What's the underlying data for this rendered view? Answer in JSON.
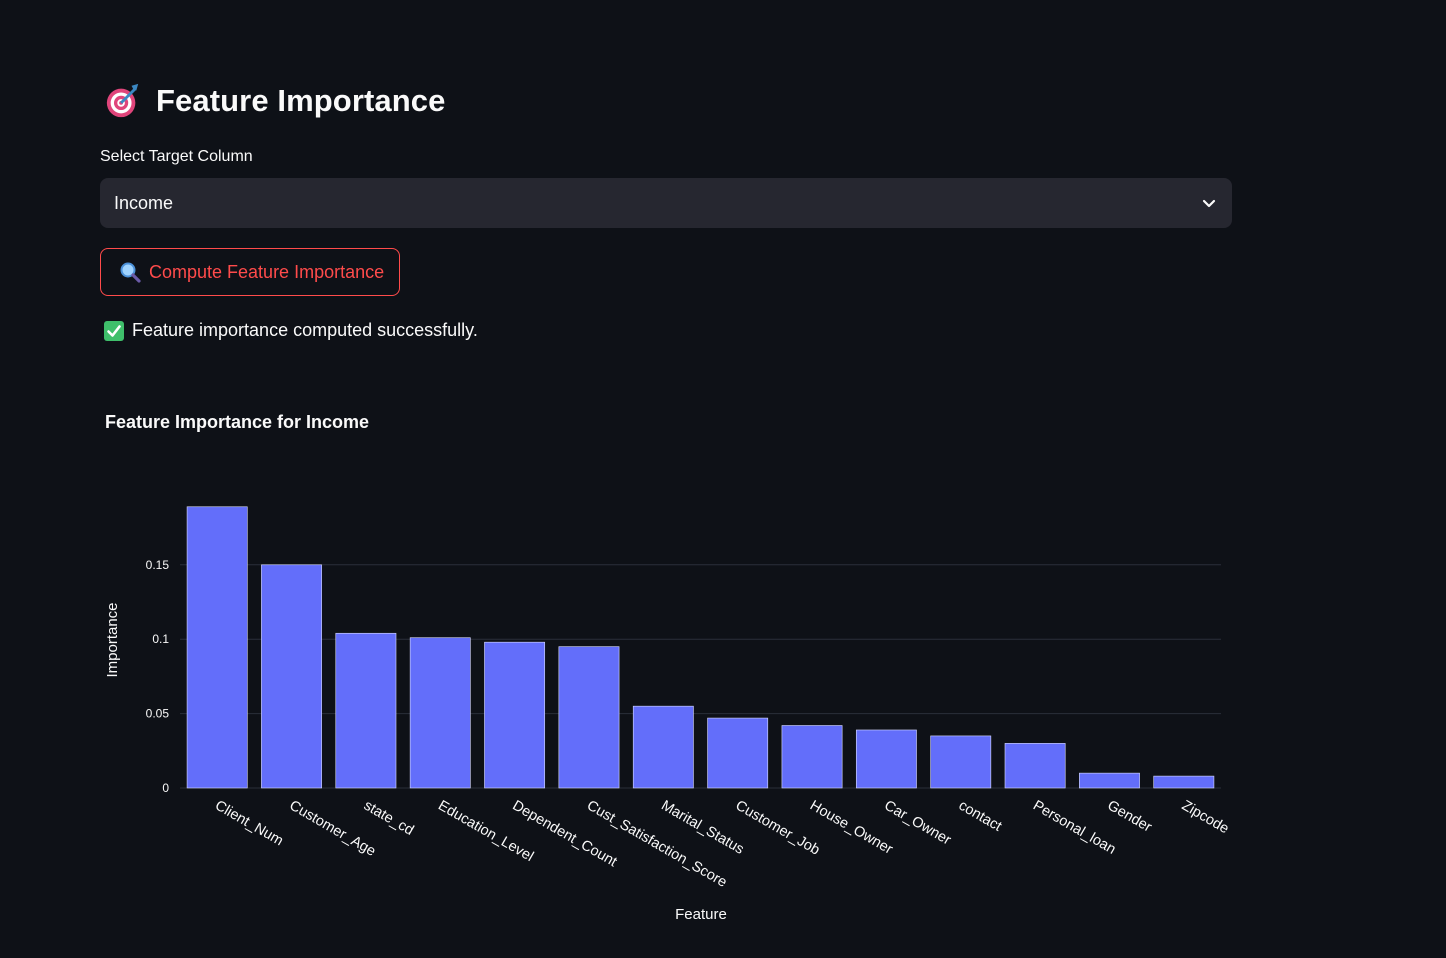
{
  "header": {
    "title": "Feature Importance",
    "icon": "target-icon"
  },
  "select": {
    "label": "Select Target Column",
    "value": "Income"
  },
  "button": {
    "label": "Compute Feature Importance",
    "icon": "magnifier-icon"
  },
  "status": {
    "message": "Feature importance computed successfully.",
    "icon": "check-icon"
  },
  "colors": {
    "bar": "#636efa",
    "accent": "#ff4b4b",
    "background": "#0e1117",
    "grid": "#2a2f3a"
  },
  "chart_data": {
    "type": "bar",
    "title": "Feature Importance for Income",
    "xlabel": "Feature",
    "ylabel": "Importance",
    "categories": [
      "Client_Num",
      "Customer_Age",
      "state_cd",
      "Education_Level",
      "Dependent_Count",
      "Cust_Satisfaction_Score",
      "Marital_Status",
      "Customer_Job",
      "House_Owner",
      "Car_Owner",
      "contact",
      "Personal_loan",
      "Gender",
      "Zipcode"
    ],
    "values": [
      0.189,
      0.15,
      0.104,
      0.101,
      0.098,
      0.095,
      0.055,
      0.047,
      0.042,
      0.039,
      0.035,
      0.03,
      0.01,
      0.008
    ],
    "yticks": [
      0,
      0.05,
      0.1,
      0.15
    ],
    "ytick_labels": [
      "0",
      "0.05",
      "0.1",
      "0.15"
    ],
    "ylim": [
      0,
      0.199
    ],
    "grid": true,
    "legend": false
  }
}
